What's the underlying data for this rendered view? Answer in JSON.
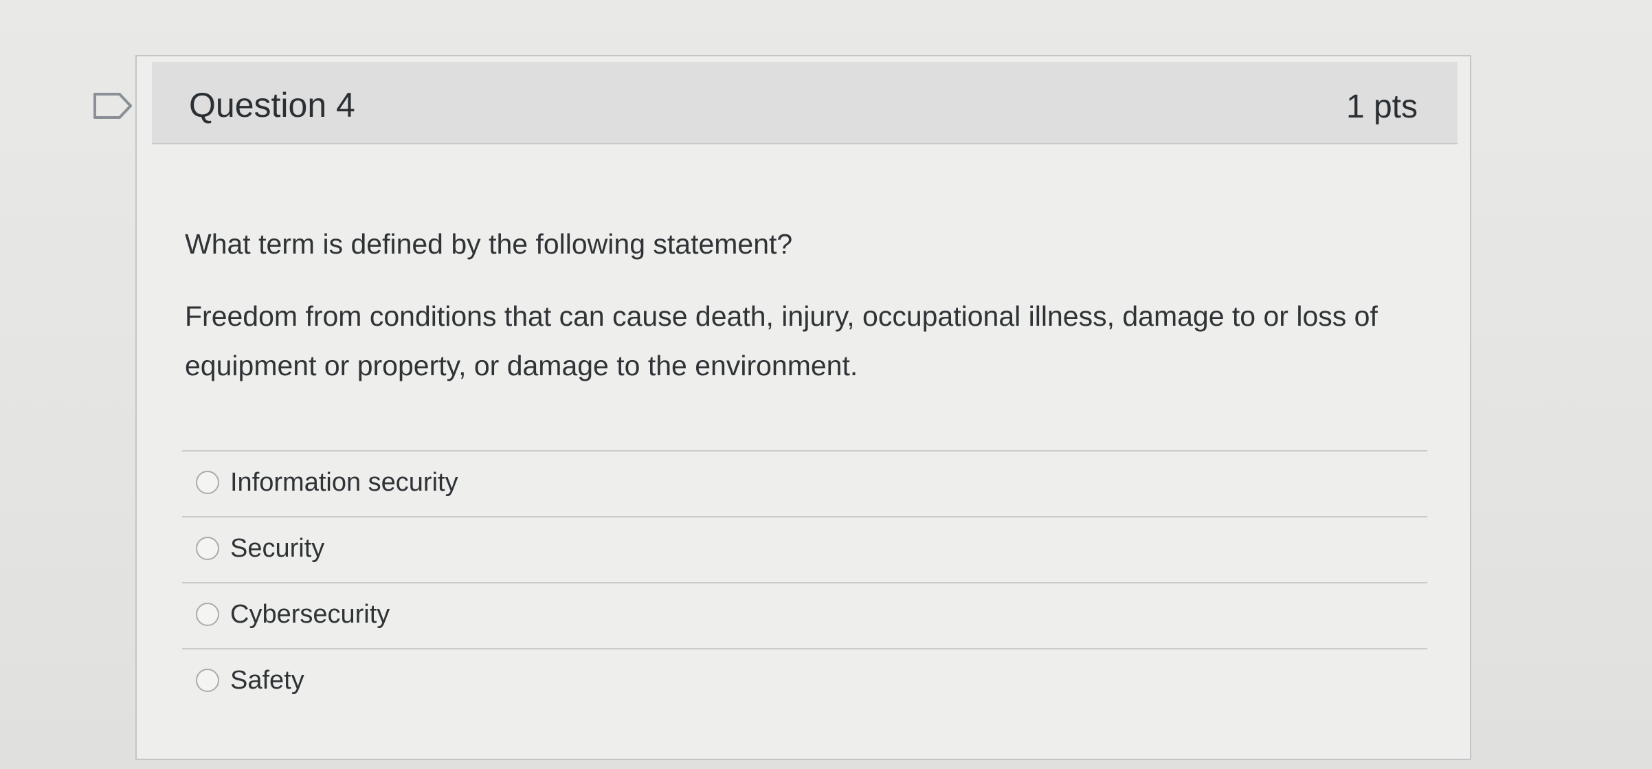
{
  "question": {
    "title": "Question 4",
    "points": "1 pts",
    "prompt": "What term is defined by the following statement?",
    "statement": "Freedom from conditions that can cause death, injury, occupational illness, damage to or loss of equipment or property, or damage to the environment.",
    "flag_icon": "flag-outline-icon",
    "answers": [
      {
        "label": "Information security"
      },
      {
        "label": "Security"
      },
      {
        "label": "Cybersecurity"
      },
      {
        "label": "Safety"
      }
    ]
  },
  "colors": {
    "background": "#e6e6e4",
    "header": "#dddedd",
    "text": "#2f3336",
    "border": "#c3c6c7"
  }
}
